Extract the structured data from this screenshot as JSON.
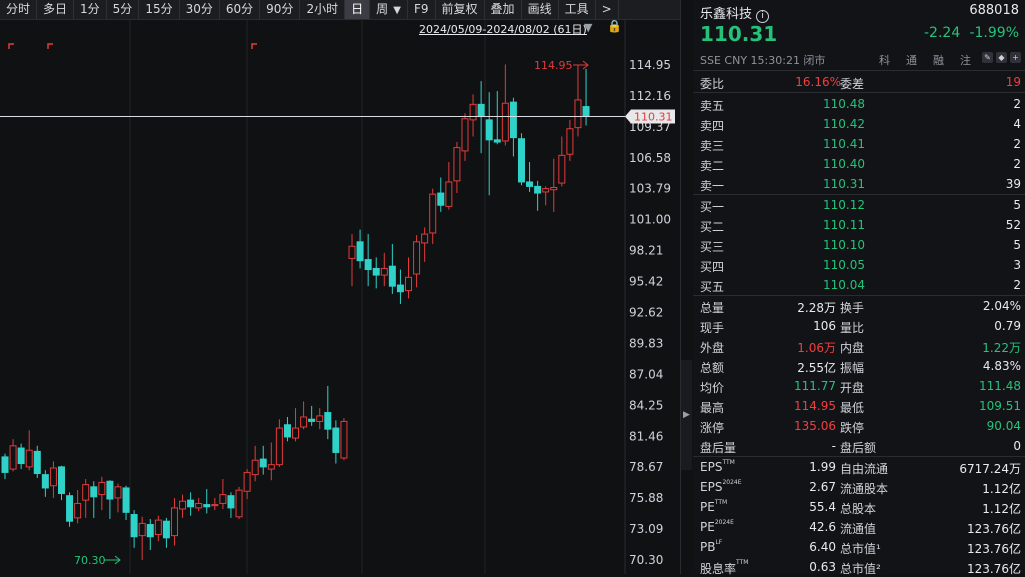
{
  "toolbar": {
    "items": [
      "分时",
      "多日",
      "1分",
      "5分",
      "15分",
      "30分",
      "60分",
      "90分",
      "2小时",
      "日",
      "周",
      "F9",
      "前复权",
      "叠加",
      "画线",
      "工具",
      ">"
    ],
    "active_index": 9
  },
  "chart": {
    "date_range": "2024/05/09-2024/08/02 (61日)",
    "y_ticks": [
      "114.95",
      "112.16",
      "109.37",
      "106.58",
      "103.79",
      "101.00",
      "98.21",
      "95.42",
      "92.62",
      "89.83",
      "87.04",
      "84.25",
      "81.46",
      "78.67",
      "75.88",
      "73.09",
      "70.30"
    ],
    "current_price_tag": "110.31",
    "max_label": "114.95",
    "min_label": "70.30",
    "colors": {
      "up": "#e23b3b",
      "down": "#2fd2c8",
      "bg": "#101113"
    }
  },
  "chart_data": {
    "type": "candlestick",
    "title": "",
    "ylim": [
      69.0,
      116.2
    ],
    "candles": [
      [
        79.6,
        78.2,
        79.9,
        77.6
      ],
      [
        78.5,
        80.6,
        81.2,
        78.3
      ],
      [
        80.4,
        79.0,
        80.8,
        78.5
      ],
      [
        78.7,
        80.2,
        82.0,
        78.4
      ],
      [
        80.1,
        78.1,
        80.6,
        77.7
      ],
      [
        78.0,
        76.8,
        78.4,
        76.0
      ],
      [
        77.0,
        78.6,
        79.2,
        75.9
      ],
      [
        78.7,
        76.3,
        78.8,
        75.7
      ],
      [
        76.1,
        73.8,
        76.4,
        73.3
      ],
      [
        74.1,
        75.4,
        76.6,
        73.6
      ],
      [
        75.7,
        77.1,
        77.6,
        74.1
      ],
      [
        76.9,
        76.0,
        77.4,
        74.1
      ],
      [
        76.2,
        77.3,
        77.8,
        74.8
      ],
      [
        77.4,
        75.8,
        77.5,
        74.0
      ],
      [
        75.9,
        76.9,
        77.2,
        74.6
      ],
      [
        76.8,
        74.6,
        77.0,
        73.9
      ],
      [
        74.4,
        72.4,
        74.8,
        71.4
      ],
      [
        72.5,
        73.6,
        74.2,
        70.3
      ],
      [
        73.5,
        72.4,
        74.0,
        71.2
      ],
      [
        72.6,
        73.9,
        74.3,
        72.0
      ],
      [
        73.8,
        72.3,
        74.1,
        71.4
      ],
      [
        72.5,
        75.0,
        75.9,
        71.6
      ],
      [
        74.9,
        75.6,
        76.2,
        74.1
      ],
      [
        75.7,
        75.1,
        76.4,
        74.3
      ],
      [
        75.0,
        75.4,
        75.9,
        74.7
      ],
      [
        75.3,
        75.1,
        76.7,
        74.5
      ],
      [
        75.2,
        75.3,
        75.9,
        74.8
      ],
      [
        75.4,
        76.2,
        77.6,
        74.9
      ],
      [
        76.1,
        75.0,
        76.4,
        74.1
      ],
      [
        74.2,
        76.6,
        76.9,
        74.0
      ],
      [
        76.5,
        78.2,
        78.5,
        75.8
      ],
      [
        78.0,
        79.3,
        80.6,
        77.4
      ],
      [
        79.4,
        78.7,
        80.6,
        78.0
      ],
      [
        78.5,
        78.9,
        80.9,
        77.5
      ],
      [
        78.9,
        82.2,
        83.0,
        78.7
      ],
      [
        82.5,
        81.4,
        83.2,
        81.0
      ],
      [
        81.3,
        82.2,
        84.0,
        81.0
      ],
      [
        82.3,
        83.2,
        84.6,
        82.1
      ],
      [
        83.0,
        82.8,
        84.2,
        82.4
      ],
      [
        82.8,
        83.3,
        84.0,
        82.1
      ],
      [
        83.6,
        82.1,
        86.0,
        81.2
      ],
      [
        82.2,
        80.0,
        82.9,
        79.0
      ],
      [
        79.5,
        82.8,
        83.1,
        79.3
      ],
      [
        97.5,
        98.6,
        99.7,
        95.0
      ],
      [
        99.0,
        97.3,
        100.1,
        96.6
      ],
      [
        97.4,
        96.5,
        99.7,
        95.0
      ],
      [
        96.6,
        96.0,
        97.6,
        94.8
      ],
      [
        96.0,
        96.6,
        98.0,
        95.0
      ],
      [
        96.8,
        95.0,
        98.8,
        94.3
      ],
      [
        95.1,
        94.5,
        96.5,
        93.4
      ],
      [
        94.6,
        95.8,
        97.6,
        93.9
      ],
      [
        96.1,
        99.0,
        99.6,
        94.9
      ],
      [
        98.9,
        99.7,
        100.3,
        97.2
      ],
      [
        99.8,
        103.3,
        103.8,
        98.8
      ],
      [
        103.4,
        102.3,
        104.8,
        101.7
      ],
      [
        102.2,
        104.4,
        106.2,
        101.9
      ],
      [
        104.5,
        107.5,
        108.0,
        103.4
      ],
      [
        107.2,
        110.1,
        110.6,
        106.3
      ],
      [
        110.0,
        111.4,
        112.3,
        108.5
      ],
      [
        111.4,
        110.3,
        113.5,
        107.0
      ],
      [
        110.0,
        108.2,
        112.5,
        103.2
      ],
      [
        108.2,
        108.0,
        112.6,
        107.8
      ],
      [
        108.1,
        111.5,
        115.0,
        107.7
      ],
      [
        111.6,
        108.4,
        112.0,
        106.7
      ],
      [
        108.3,
        104.4,
        108.8,
        104.1
      ],
      [
        104.4,
        104.0,
        106.2,
        103.5
      ],
      [
        104.0,
        103.4,
        104.5,
        101.8
      ],
      [
        103.5,
        103.8,
        104.0,
        102.3
      ],
      [
        103.7,
        103.9,
        106.5,
        101.7
      ],
      [
        104.3,
        106.8,
        108.5,
        104.0
      ],
      [
        106.9,
        109.2,
        110.0,
        106.3
      ],
      [
        109.3,
        111.8,
        114.9,
        108.5
      ],
      [
        111.2,
        110.3,
        114.6,
        109.5
      ]
    ]
  },
  "stock": {
    "name": "乐鑫科技",
    "info_icon": "info-circle-icon",
    "code": "688018",
    "price": "110.31",
    "change": "-2.24",
    "change_pct": "-1.99%",
    "meta": "SSE  CNY  15:30:21  闭市",
    "tags": [
      "科",
      "通",
      "融",
      "注"
    ]
  },
  "ratio": {
    "label1": "委比",
    "value1": "16.16%",
    "label2": "委差",
    "value2": "19"
  },
  "asks": [
    {
      "label": "卖五",
      "price": "110.48",
      "vol": "2"
    },
    {
      "label": "卖四",
      "price": "110.42",
      "vol": "4"
    },
    {
      "label": "卖三",
      "price": "110.41",
      "vol": "2"
    },
    {
      "label": "卖二",
      "price": "110.40",
      "vol": "2"
    },
    {
      "label": "卖一",
      "price": "110.31",
      "vol": "39"
    }
  ],
  "bids": [
    {
      "label": "买一",
      "price": "110.12",
      "vol": "5"
    },
    {
      "label": "买二",
      "price": "110.11",
      "vol": "52"
    },
    {
      "label": "买三",
      "price": "110.10",
      "vol": "5"
    },
    {
      "label": "买四",
      "price": "110.05",
      "vol": "3"
    },
    {
      "label": "买五",
      "price": "110.04",
      "vol": "2"
    }
  ],
  "stats": [
    {
      "l1": "总量",
      "v1": "2.28万",
      "l2": "换手",
      "v2": "2.04%",
      "c1": "w",
      "c2": "w"
    },
    {
      "l1": "现手",
      "v1": "106",
      "l2": "量比",
      "v2": "0.79",
      "c1": "w",
      "c2": "w"
    },
    {
      "l1": "外盘",
      "v1": "1.06万",
      "l2": "内盘",
      "v2": "1.22万",
      "c1": "r",
      "c2": "g"
    },
    {
      "l1": "总额",
      "v1": "2.55亿",
      "l2": "振幅",
      "v2": "4.83%",
      "c1": "w",
      "c2": "w"
    },
    {
      "l1": "均价",
      "v1": "111.77",
      "l2": "开盘",
      "v2": "111.48",
      "c1": "g",
      "c2": "g"
    },
    {
      "l1": "最高",
      "v1": "114.95",
      "l2": "最低",
      "v2": "109.51",
      "c1": "r",
      "c2": "g"
    },
    {
      "l1": "涨停",
      "v1": "135.06",
      "l2": "跌停",
      "v2": "90.04",
      "c1": "r",
      "c2": "g"
    },
    {
      "l1": "盘后量",
      "v1": "-",
      "l2": "盘后额",
      "v2": "0",
      "c1": "w",
      "c2": "w"
    }
  ],
  "fundamentals": [
    {
      "l1": "EPS",
      "s1": "TTM",
      "v1": "1.99",
      "l2": "自由流通",
      "v2": "6717.24万"
    },
    {
      "l1": "EPS",
      "s1": "2024E",
      "v1": "2.67",
      "l2": "流通股本",
      "v2": "1.12亿"
    },
    {
      "l1": "PE",
      "s1": "TTM",
      "v1": "55.4",
      "l2": "总股本",
      "v2": "1.12亿"
    },
    {
      "l1": "PE",
      "s1": "2024E",
      "v1": "42.6",
      "l2": "流通值",
      "v2": "123.76亿"
    },
    {
      "l1": "PB",
      "s1": "LF",
      "v1": "6.40",
      "l2": "总市值¹",
      "v2": "123.76亿"
    },
    {
      "l1": "股息率",
      "s1": "TTM",
      "v1": "0.63",
      "l2": "总市值²",
      "v2": "123.76亿"
    }
  ]
}
